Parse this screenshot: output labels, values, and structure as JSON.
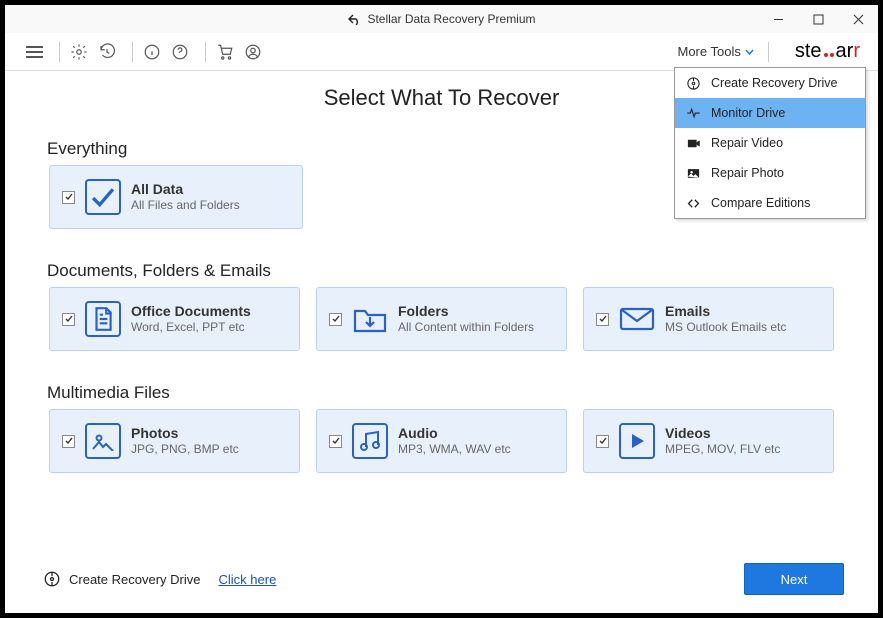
{
  "titlebar": {
    "title": "Stellar Data Recovery Premium"
  },
  "toolbar": {
    "more_tools": "More Tools"
  },
  "logo": {
    "pre": "ste",
    "post": "ar"
  },
  "main": {
    "title": "Select What To Recover"
  },
  "sections": {
    "everything": {
      "title": "Everything",
      "all_data": {
        "title": "All Data",
        "sub": "All Files and Folders"
      }
    },
    "docs": {
      "title": "Documents, Folders & Emails",
      "office": {
        "title": "Office Documents",
        "sub": "Word, Excel, PPT etc"
      },
      "folders": {
        "title": "Folders",
        "sub": "All Content within Folders"
      },
      "emails": {
        "title": "Emails",
        "sub": "MS Outlook Emails etc"
      }
    },
    "multimedia": {
      "title": "Multimedia Files",
      "photos": {
        "title": "Photos",
        "sub": "JPG, PNG, BMP etc"
      },
      "audio": {
        "title": "Audio",
        "sub": "MP3, WMA, WAV etc"
      },
      "videos": {
        "title": "Videos",
        "sub": "MPEG, MOV, FLV etc"
      }
    }
  },
  "footer": {
    "label": "Create Recovery Drive",
    "link": "Click here",
    "next": "Next"
  },
  "dropdown": {
    "items": [
      {
        "label": "Create Recovery Drive"
      },
      {
        "label": "Monitor Drive"
      },
      {
        "label": "Repair Video"
      },
      {
        "label": "Repair Photo"
      },
      {
        "label": "Compare Editions"
      }
    ]
  }
}
